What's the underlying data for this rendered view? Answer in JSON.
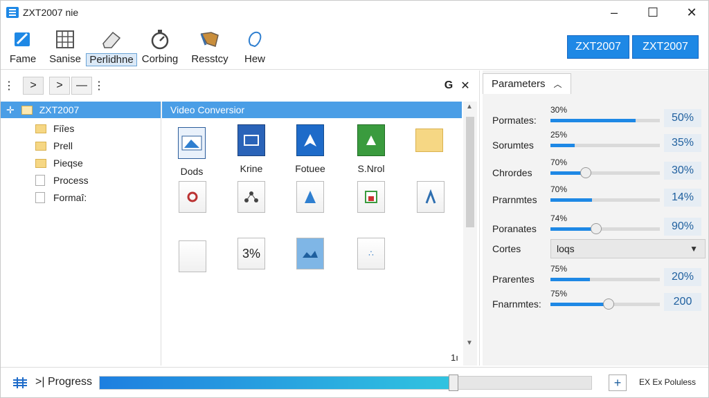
{
  "window": {
    "title": "ZXT2007 nie",
    "controls": [
      "–",
      "☐",
      "✕"
    ]
  },
  "ribbon": {
    "buttons": [
      "Fame",
      "Sanise",
      "Perlidhne",
      "Corbing",
      "Resstcy",
      "Hew"
    ],
    "selected_index": 2,
    "right_buttons": [
      "ZXT2007",
      "ZXT2007"
    ]
  },
  "toolbar": {
    "buttons": [
      "⋮",
      ">",
      ">",
      "—",
      "⋮"
    ],
    "right_icons": [
      "G",
      "✕"
    ]
  },
  "tree": {
    "root": "ZXT2007",
    "items": [
      "Fiîes",
      "Prell",
      "Pieqse",
      "Process",
      "Formaî:"
    ]
  },
  "content": {
    "header": "Video Conversior",
    "files": [
      "Dods",
      "Krine",
      "Fotuee",
      "S.Nrol",
      "",
      "",
      "",
      "",
      "",
      "",
      "",
      "3%",
      "",
      ""
    ],
    "corner_text": "1ı"
  },
  "parameters": {
    "tab": "Parameters",
    "rows": [
      {
        "label": "Pormates:",
        "pct": "30%",
        "value": "50%",
        "fill": 0.78,
        "knob": false
      },
      {
        "label": "Sorumtes",
        "pct": "25%",
        "value": "35%",
        "fill": 0.22,
        "knob": false
      },
      {
        "label": "Chrordes",
        "pct": "70%",
        "value": "30%",
        "fill": 0.32,
        "knob": true
      },
      {
        "label": "Prarnmtes",
        "pct": "70%",
        "value": "14%",
        "fill": 0.38,
        "knob": false
      },
      {
        "label": "Poranates",
        "pct": "74%",
        "value": "90%",
        "fill": 0.42,
        "knob": true
      },
      {
        "label": "Prarentes",
        "pct": "75%",
        "value": "20%",
        "fill": 0.36,
        "knob": false
      },
      {
        "label": "Fnarnmtes:",
        "pct": "75%",
        "value": "200",
        "fill": 0.53,
        "knob": true
      }
    ],
    "select": {
      "label": "Cortes",
      "value": "loqs"
    }
  },
  "status": {
    "label": ">| Progress",
    "progress": 0.72,
    "plus": "+",
    "right_text": "EX Ex Poluless"
  }
}
